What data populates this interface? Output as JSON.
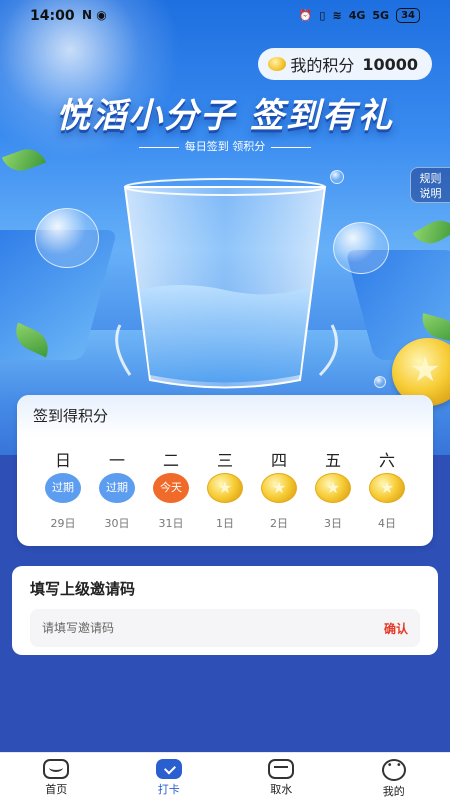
{
  "status_bar": {
    "time": "14:00",
    "left_icons": "N ◉",
    "right_icons": [
      "alarm-icon",
      "vibrate-icon",
      "wifi-icon",
      "signal-4g-icon",
      "signal-5g-icon"
    ],
    "network_4g": "4G",
    "network_5g": "5G",
    "battery": "34"
  },
  "points": {
    "label": "我的积分",
    "value": "10000"
  },
  "hero": {
    "title": "悦滔小分子 签到有礼",
    "subtitle": "每日签到 领积分",
    "rules_line1": "规则",
    "rules_line2": "说明"
  },
  "signin": {
    "title": "签到得积分",
    "days": [
      {
        "name": "日",
        "status": "过期",
        "date": "29日"
      },
      {
        "name": "一",
        "status": "过期",
        "date": "30日"
      },
      {
        "name": "二",
        "status": "今天",
        "date": "31日"
      },
      {
        "name": "三",
        "status": "coin",
        "date": "1日"
      },
      {
        "name": "四",
        "status": "coin",
        "date": "2日"
      },
      {
        "name": "五",
        "status": "coin",
        "date": "3日"
      },
      {
        "name": "六",
        "status": "coin",
        "date": "4日"
      }
    ]
  },
  "invite": {
    "title": "填写上级邀请码",
    "placeholder": "请填写邀请码",
    "confirm": "确认"
  },
  "tabbar": {
    "items": [
      {
        "label": "首页",
        "icon": "home-icon"
      },
      {
        "label": "打卡",
        "icon": "checkin-icon"
      },
      {
        "label": "取水",
        "icon": "water-dispenser-icon"
      },
      {
        "label": "我的",
        "icon": "profile-icon"
      }
    ],
    "active_index": 1
  },
  "colors": {
    "accent": "#2a5fd0",
    "today": "#f06b2a",
    "expired": "#5d9df0",
    "confirm": "#e53a2a",
    "background": "#2d4fb6"
  }
}
